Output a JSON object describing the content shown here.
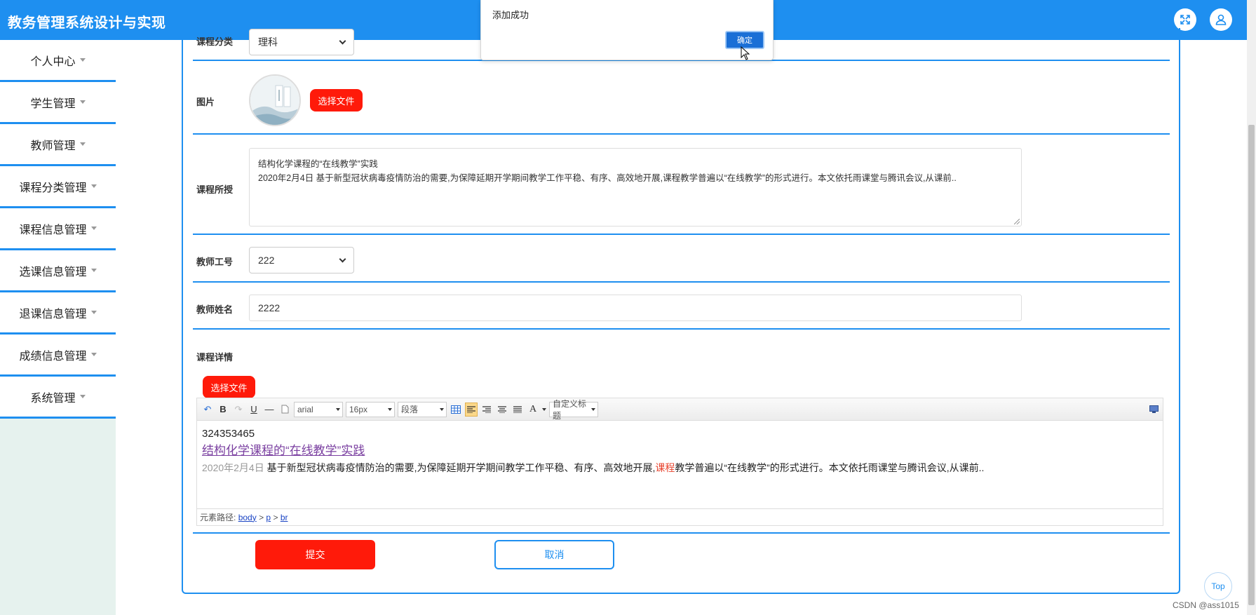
{
  "header": {
    "title": "教务管理系统设计与实现"
  },
  "sidebar": {
    "items": [
      {
        "label": "个人中心"
      },
      {
        "label": "学生管理"
      },
      {
        "label": "教师管理"
      },
      {
        "label": "课程分类管理"
      },
      {
        "label": "课程信息管理"
      },
      {
        "label": "选课信息管理"
      },
      {
        "label": "退课信息管理"
      },
      {
        "label": "成绩信息管理"
      },
      {
        "label": "系统管理"
      }
    ]
  },
  "form": {
    "category": {
      "label": "课程分类",
      "value": "理科"
    },
    "image": {
      "label": "图片",
      "button": "选择文件"
    },
    "taught": {
      "label": "课程所授",
      "line1": "结构化学课程的“在线教学”实践",
      "line2": "2020年2月4日 基于新型冠状病毒疫情防治的需要,为保障延期开学期间教学工作平稳、有序、高效地开展,课程教学普遍以“在线教学”的形式进行。本文依托雨课堂与腾讯会议,从课前.."
    },
    "teacher_id": {
      "label": "教师工号",
      "value": "222"
    },
    "teacher_name": {
      "label": "教师姓名",
      "value": "2222"
    },
    "detail": {
      "label": "课程详情",
      "button": "选择文件",
      "toolbar": {
        "font": "arial",
        "size": "16px",
        "paragraph": "段落",
        "custom_title": "自定义标题"
      },
      "content": {
        "line1": "324353465",
        "line2": "结构化学课程的“在线教学”实践",
        "line3_date": "2020年2月4日",
        "line3_a": " 基于新型冠状病毒疫情防治的需要,为保障延期开学期间教学工作平稳、有序、高效地开展,",
        "line3_highlight": "课程",
        "line3_b": "教学普遍以“在线教学”的形式进行。本文依托雨课堂与腾讯会议,从课前.."
      },
      "path": {
        "label": "元素路径:",
        "body": "body",
        "p": "p",
        "br": "br",
        "sep": ">"
      }
    },
    "submit": "提交",
    "cancel": "取消"
  },
  "dialog": {
    "message": "添加成功",
    "ok": "确定"
  },
  "top_button": "Top",
  "watermark": "CSDN @ass1015",
  "colors": {
    "primary": "#1e8ff0",
    "danger": "#ff1a0a",
    "sidebar_bg": "#e6f2ee"
  }
}
